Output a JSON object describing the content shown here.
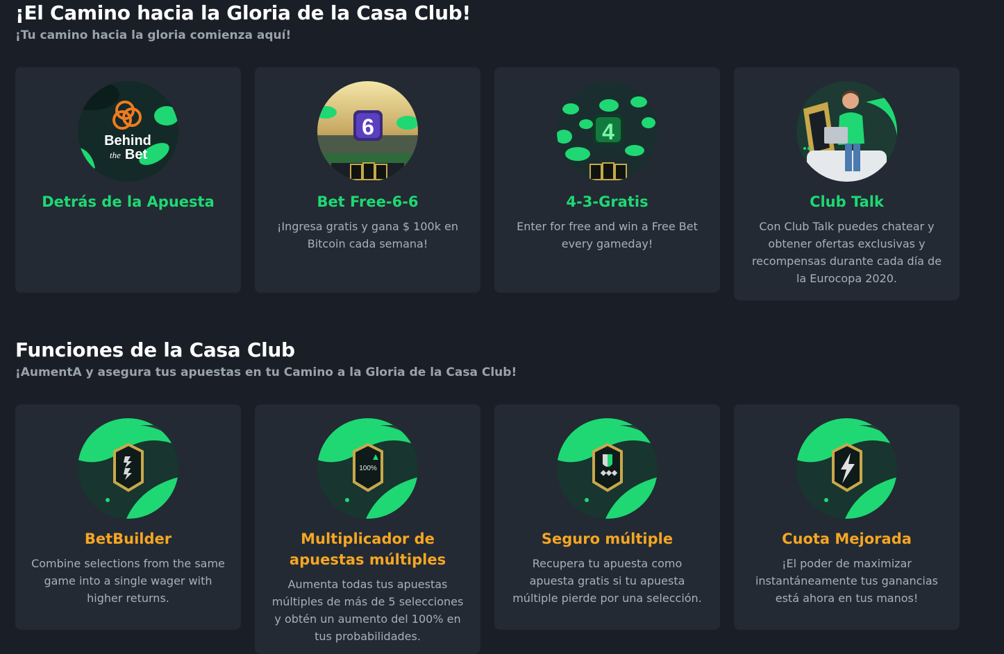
{
  "section1": {
    "title": "¡El Camino hacia la Gloria de la Casa Club!",
    "subtitle": "¡Tu camino hacia la gloria comienza aquí!",
    "cards": [
      {
        "title": "Detrás de la Apuesta",
        "description": "",
        "logo_line1": "Behind",
        "logo_line2a": "the",
        "logo_line2b": "Bet",
        "icon": "behind-the-bet-logo"
      },
      {
        "title": "Bet Free-6-6",
        "description": "¡Ingresa gratis y gana $ 100k en Bitcoin cada semana!",
        "badge": "6",
        "icon": "stadium-six-badge"
      },
      {
        "title": "4-3-Gratis",
        "description": "Enter for free and win a Free Bet every gameday!",
        "badge": "4",
        "icon": "four-badge"
      },
      {
        "title": "Club Talk",
        "description": "Con Club Talk puedes chatear y obtener ofertas exclusivas y recompensas durante cada día de la Eurocopa 2020.",
        "icon": "man-with-laptop-illustration"
      }
    ]
  },
  "section2": {
    "title": "Funciones de la Casa Club",
    "subtitle": "¡AumentA y asegura tus apuestas en tu Camino a la Gloria de la Casa Club!",
    "cards": [
      {
        "title": "BetBuilder",
        "description": "Combine selections from the same game into a single wager with higher returns.",
        "icon": "betbuilder-shield-icon"
      },
      {
        "title": "Multiplicador de apuestas múltiples",
        "description": "Aumenta todas tus apuestas múltiples de más de 5 selecciones y obtén un aumento del 100% en tus probabilidades.",
        "badge": "100%",
        "icon": "multiplier-shield-icon"
      },
      {
        "title": "Seguro múltiple",
        "description": "Recupera tu apuesta como apuesta gratis si tu apuesta múltiple pierde por una selección.",
        "icon": "insurance-shield-icon"
      },
      {
        "title": "Cuota Mejorada",
        "description": "¡El poder de maximizar instantáneamente tus ganancias está ahora en tus manos!",
        "icon": "lightning-shield-icon"
      }
    ]
  },
  "colors": {
    "background": "#1a1f27",
    "card": "#232a33",
    "accent_green": "#1fd873",
    "accent_gold": "#f5a623",
    "muted_text": "#a9b0b9"
  }
}
